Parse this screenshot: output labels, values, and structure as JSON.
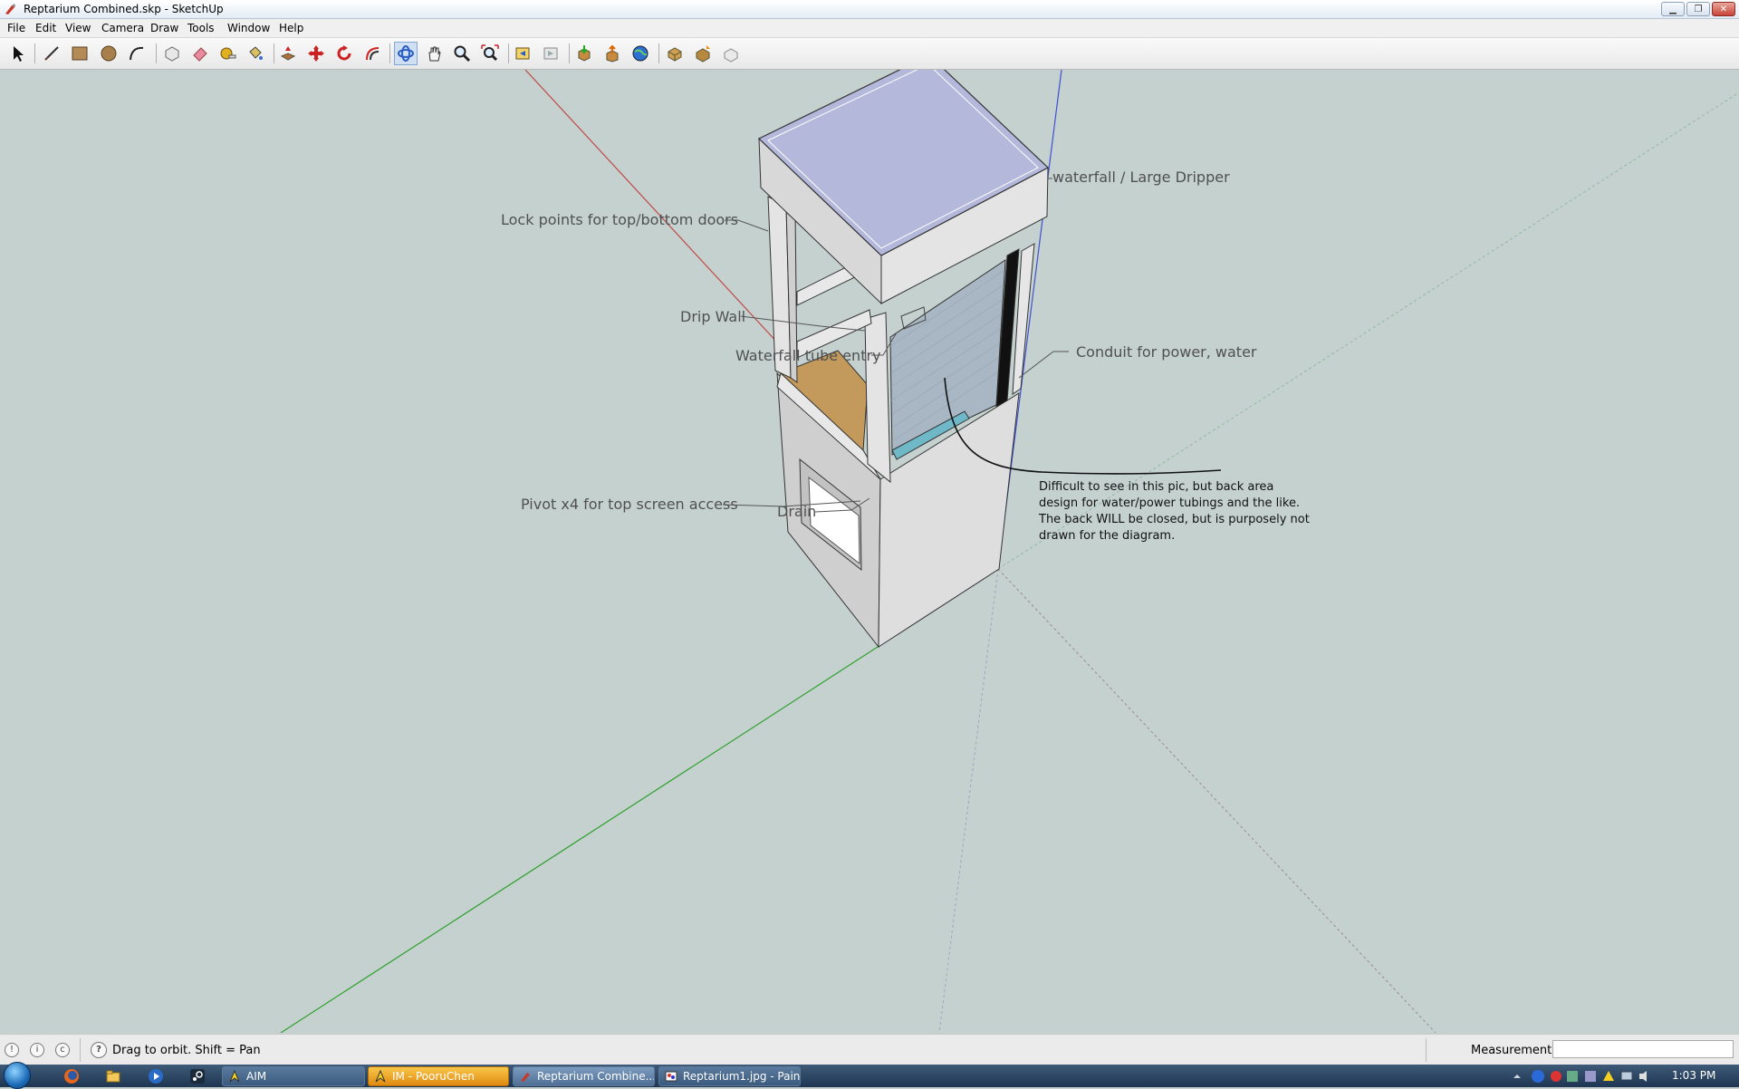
{
  "window": {
    "title": "Reptarium Combined.skp - SketchUp",
    "controls": [
      "minimize",
      "restore",
      "close"
    ]
  },
  "menu": {
    "items": [
      "File",
      "Edit",
      "View",
      "Camera",
      "Draw",
      "Tools",
      "Window",
      "Help"
    ]
  },
  "toolbar": {
    "tools": [
      {
        "name": "select-icon"
      },
      {
        "name": "line-icon"
      },
      {
        "name": "rectangle-icon"
      },
      {
        "name": "circle-icon"
      },
      {
        "name": "arc-icon"
      },
      {
        "name": "make-component-icon"
      },
      {
        "name": "eraser-icon"
      },
      {
        "name": "tape-measure-icon"
      },
      {
        "name": "paint-bucket-icon"
      },
      {
        "name": "push-pull-icon"
      },
      {
        "name": "move-icon"
      },
      {
        "name": "rotate-icon"
      },
      {
        "name": "offset-icon"
      },
      {
        "name": "orbit-icon",
        "active": true
      },
      {
        "name": "pan-icon"
      },
      {
        "name": "zoom-icon"
      },
      {
        "name": "zoom-extents-icon"
      },
      {
        "name": "previous-view-icon"
      },
      {
        "name": "next-view-icon"
      },
      {
        "name": "get-models-icon"
      },
      {
        "name": "share-model-icon"
      },
      {
        "name": "google-earth-icon"
      },
      {
        "name": "components-icon"
      },
      {
        "name": "share-component-icon"
      },
      {
        "name": "extension-icon"
      }
    ]
  },
  "canvas": {
    "labels": {
      "waterfall": "waterfall / Large Dripper",
      "lock_points": "Lock points for top/bottom doors",
      "drip_wall": "Drip Wall",
      "waterfall_tube": "Waterfall tube entry",
      "conduit": "Conduit for power, water",
      "pivot": "Pivot x4 for top screen access",
      "drain": "Drain"
    },
    "note": "Difficult to see in this pic, but back area design for water/power tubings and the like. The back WILL be closed, but is purposely not drawn for the diagram.",
    "colors": {
      "background": "#c5d1cf",
      "red_axis": "#c04848",
      "green_axis": "#2ea02e",
      "blue_axis": "#3f4fd0",
      "top_face": "#b4b8da",
      "wall": "#d6d6d6",
      "substrate": "#c49a5c",
      "glass": "#a9b7c4"
    }
  },
  "status": {
    "hint": "Drag to orbit.  Shift = Pan",
    "measurements_label": "Measurements",
    "measurements_value": ""
  },
  "taskbar": {
    "tasks": [
      {
        "label": "AIM",
        "state": "normal"
      },
      {
        "label": "IM - PooruChen",
        "state": "flash"
      },
      {
        "label": "Reptarium Combine...",
        "state": "active"
      },
      {
        "label": "Reptarium1.jpg - Paint",
        "state": "normal"
      }
    ],
    "clock": "1:03 PM"
  }
}
